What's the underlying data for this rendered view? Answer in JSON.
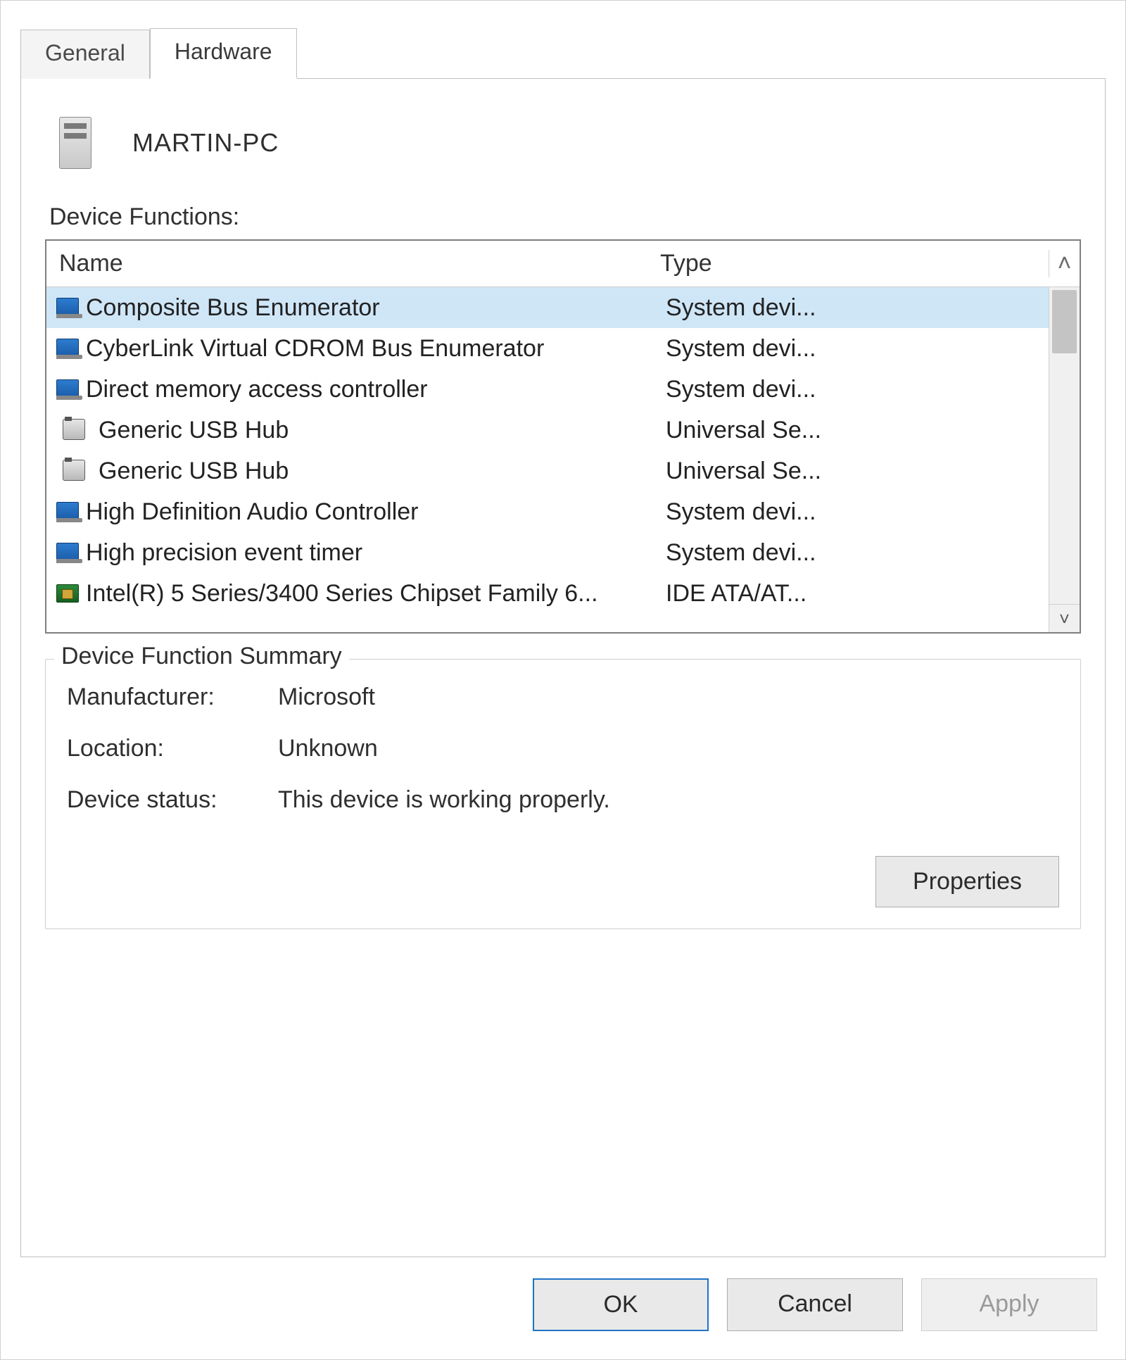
{
  "tabs": {
    "general": "General",
    "hardware": "Hardware"
  },
  "computer_name": "MARTIN-PC",
  "device_functions_label": "Device Functions:",
  "columns": {
    "name": "Name",
    "type": "Type"
  },
  "devices": [
    {
      "name": "Composite Bus Enumerator",
      "type": "System devi...",
      "icon": "system",
      "selected": true
    },
    {
      "name": "CyberLink Virtual CDROM Bus Enumerator",
      "type": "System devi...",
      "icon": "system"
    },
    {
      "name": "Direct memory access controller",
      "type": "System devi...",
      "icon": "system"
    },
    {
      "name": "Generic USB Hub",
      "type": "Universal Se...",
      "icon": "usb"
    },
    {
      "name": "Generic USB Hub",
      "type": "Universal Se...",
      "icon": "usb"
    },
    {
      "name": "High Definition Audio Controller",
      "type": "System devi...",
      "icon": "system"
    },
    {
      "name": "High precision event timer",
      "type": "System devi...",
      "icon": "system"
    },
    {
      "name": "Intel(R) 5 Series/3400 Series Chipset Family 6...",
      "type": "IDE ATA/AT...",
      "icon": "chip"
    }
  ],
  "summary": {
    "title": "Device Function Summary",
    "manufacturer_label": "Manufacturer:",
    "manufacturer_value": "Microsoft",
    "location_label": "Location:",
    "location_value": "Unknown",
    "status_label": "Device status:",
    "status_value": "This device is working properly."
  },
  "buttons": {
    "properties": "Properties",
    "ok": "OK",
    "cancel": "Cancel",
    "apply": "Apply"
  },
  "glyphs": {
    "up": "˄",
    "down": "˅"
  }
}
